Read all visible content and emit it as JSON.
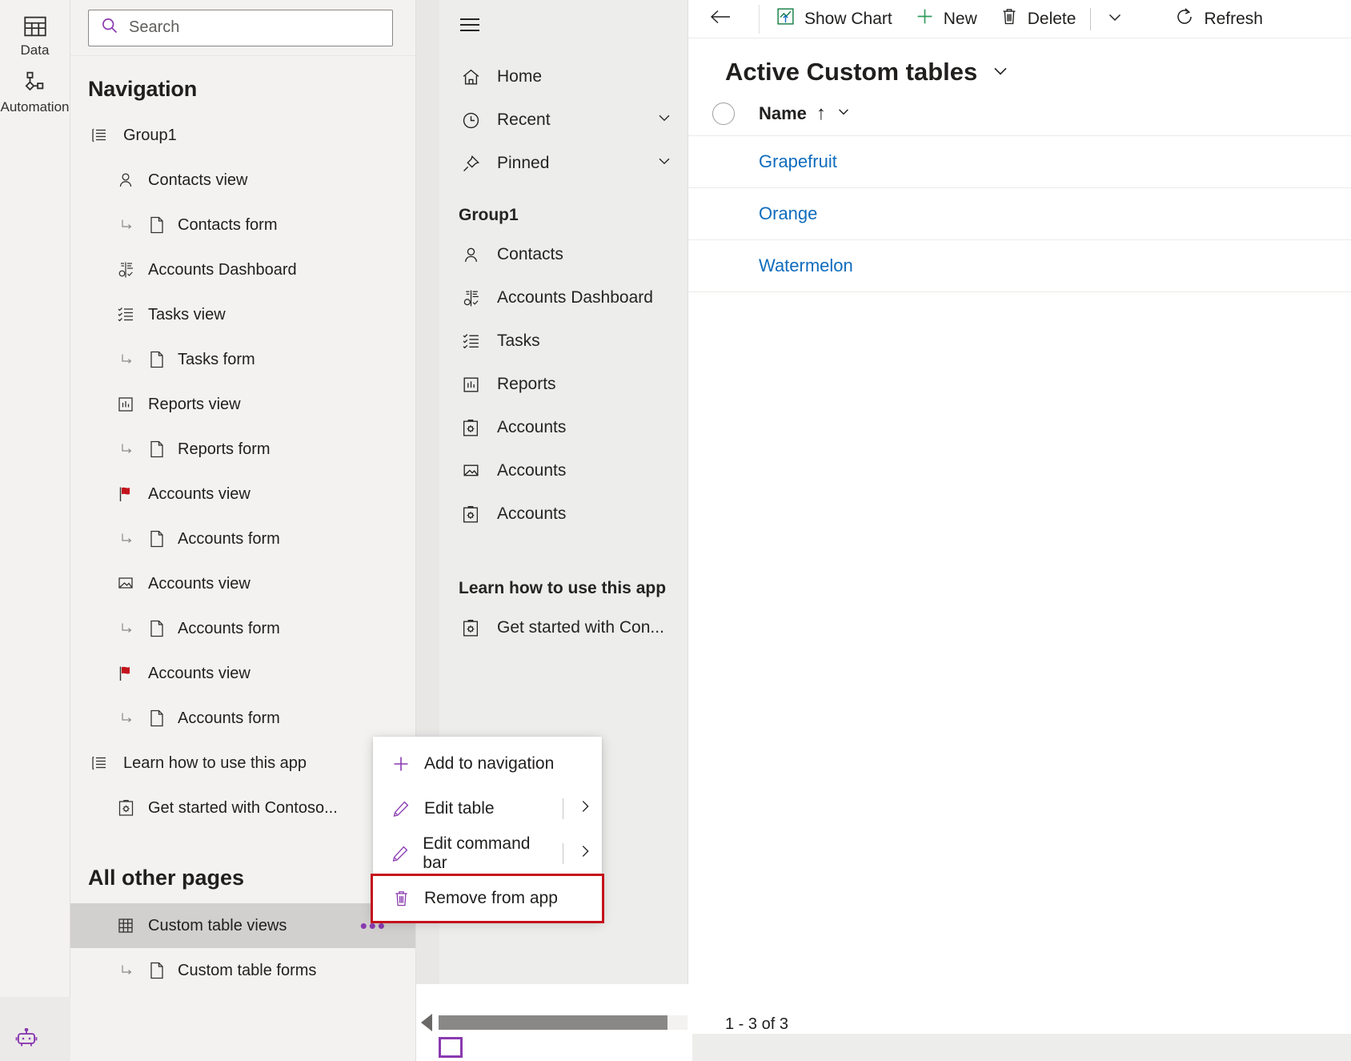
{
  "rail": {
    "items": [
      {
        "label": "Data",
        "icon": "table-icon"
      },
      {
        "label": "Automation",
        "icon": "automation-icon"
      }
    ],
    "bottom_icon": "copilot-robot-icon"
  },
  "search": {
    "placeholder": "Search",
    "value": "",
    "icon": "search-icon"
  },
  "navigation": {
    "title": "Navigation",
    "all_other_pages_header": "All other pages",
    "items": [
      {
        "label": "Group1",
        "icon": "group-list-icon",
        "level": "group",
        "selected": false
      },
      {
        "label": "Contacts view",
        "icon": "contact-person-icon",
        "level": "child",
        "selected": false
      },
      {
        "label": "Contacts form",
        "icon": "form-page-icon",
        "level": "sub",
        "selected": false
      },
      {
        "label": "Accounts Dashboard",
        "icon": "dashboard-icon",
        "level": "child",
        "selected": false
      },
      {
        "label": "Tasks view",
        "icon": "task-list-icon",
        "level": "child",
        "selected": false
      },
      {
        "label": "Tasks form",
        "icon": "form-page-icon",
        "level": "sub",
        "selected": false
      },
      {
        "label": "Reports view",
        "icon": "report-chart-icon",
        "level": "child",
        "selected": false
      },
      {
        "label": "Reports form",
        "icon": "form-page-icon",
        "level": "sub",
        "selected": false
      },
      {
        "label": "Accounts view",
        "icon": "red-flag-icon",
        "level": "child",
        "selected": false
      },
      {
        "label": "Accounts form",
        "icon": "form-page-icon",
        "level": "sub",
        "selected": false
      },
      {
        "label": "Accounts view",
        "icon": "folder-arrow-icon",
        "level": "child",
        "selected": false
      },
      {
        "label": "Accounts form",
        "icon": "form-page-icon",
        "level": "sub",
        "selected": false
      },
      {
        "label": "Accounts view",
        "icon": "red-flag-icon",
        "level": "child",
        "selected": false
      },
      {
        "label": "Accounts form",
        "icon": "form-page-icon",
        "level": "sub",
        "selected": false
      },
      {
        "label": "Learn how to use this app",
        "icon": "group-list-icon",
        "level": "group",
        "selected": false
      },
      {
        "label": "Get started with Contoso...",
        "icon": "clipboard-gear-icon",
        "level": "child",
        "selected": false
      }
    ],
    "other_pages": [
      {
        "label": "Custom table views",
        "icon": "table-grid-icon",
        "level": "child",
        "selected": true,
        "more": "•••"
      },
      {
        "label": "Custom table forms",
        "icon": "form-page-icon",
        "level": "sub",
        "selected": false
      }
    ]
  },
  "context_menu": {
    "items": [
      {
        "label": "Add to navigation",
        "icon": "plus-icon",
        "submenu": false,
        "highlighted": false
      },
      {
        "label": "Edit table",
        "icon": "pencil-icon",
        "submenu": true,
        "highlighted": false
      },
      {
        "label": "Edit command bar",
        "icon": "pencil-icon",
        "submenu": true,
        "highlighted": false
      },
      {
        "label": "Remove from app",
        "icon": "trash-icon",
        "submenu": false,
        "highlighted": true
      }
    ],
    "highlight_color": "#c4121b"
  },
  "app_preview": {
    "hamburger_icon": "hamburger-icon",
    "top_items": [
      {
        "label": "Home",
        "icon": "home-icon",
        "chevron": false
      },
      {
        "label": "Recent",
        "icon": "clock-icon",
        "chevron": true
      },
      {
        "label": "Pinned",
        "icon": "pin-icon",
        "chevron": true
      }
    ],
    "group_header": "Group1",
    "group_items": [
      {
        "label": "Contacts",
        "icon": "contact-person-icon"
      },
      {
        "label": "Accounts Dashboard",
        "icon": "dashboard-icon"
      },
      {
        "label": "Tasks",
        "icon": "task-list-icon"
      },
      {
        "label": "Reports",
        "icon": "report-chart-icon"
      },
      {
        "label": "Accounts",
        "icon": "clipboard-gear-icon"
      },
      {
        "label": "Accounts",
        "icon": "folder-arrow-icon"
      },
      {
        "label": "Accounts",
        "icon": "clipboard-gear-icon"
      }
    ],
    "learn_header": "Learn how to use this app",
    "learn_items": [
      {
        "label": "Get started with Con...",
        "icon": "clipboard-gear-icon"
      }
    ]
  },
  "command_bar": {
    "back_icon": "back-arrow-icon",
    "buttons": [
      {
        "label": "Show Chart",
        "icon": "show-chart-icon"
      },
      {
        "label": "New",
        "icon": "plus-icon"
      },
      {
        "label": "Delete",
        "icon": "trash-icon"
      }
    ],
    "overflow_icon": "chevron-down-icon",
    "refresh": {
      "label": "Refresh",
      "icon": "refresh-icon"
    }
  },
  "main": {
    "view_title": "Active Custom tables",
    "view_title_chevron": "chevron-down-icon",
    "columns": [
      {
        "label": "Name",
        "sort": "↑",
        "chevron": "chevron-down-icon"
      }
    ],
    "rows": [
      {
        "name": "Grapefruit"
      },
      {
        "name": "Orange"
      },
      {
        "name": "Watermelon"
      }
    ],
    "record_count": "1 - 3 of 3",
    "link_color": "#0f6cbd"
  },
  "scrollbar": {
    "left_arrow": "scroll-left-arrow"
  }
}
